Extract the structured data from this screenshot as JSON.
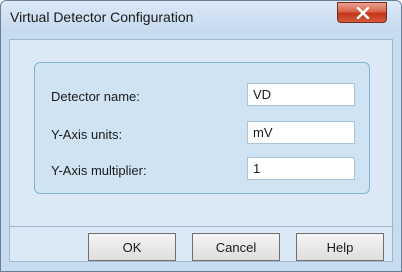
{
  "window": {
    "title": "Virtual Detector Configuration",
    "close_icon": "close-icon"
  },
  "form": {
    "detector_name": {
      "label": "Detector name:",
      "value": "VD"
    },
    "y_axis_units": {
      "label": "Y-Axis units:",
      "value": "mV"
    },
    "y_axis_multiplier": {
      "label": "Y-Axis multiplier:",
      "value": "1"
    }
  },
  "buttons": {
    "ok": "OK",
    "cancel": "Cancel",
    "help": "Help"
  },
  "colors": {
    "accent": "#c8dcf0",
    "close_button": "#c2351b"
  }
}
